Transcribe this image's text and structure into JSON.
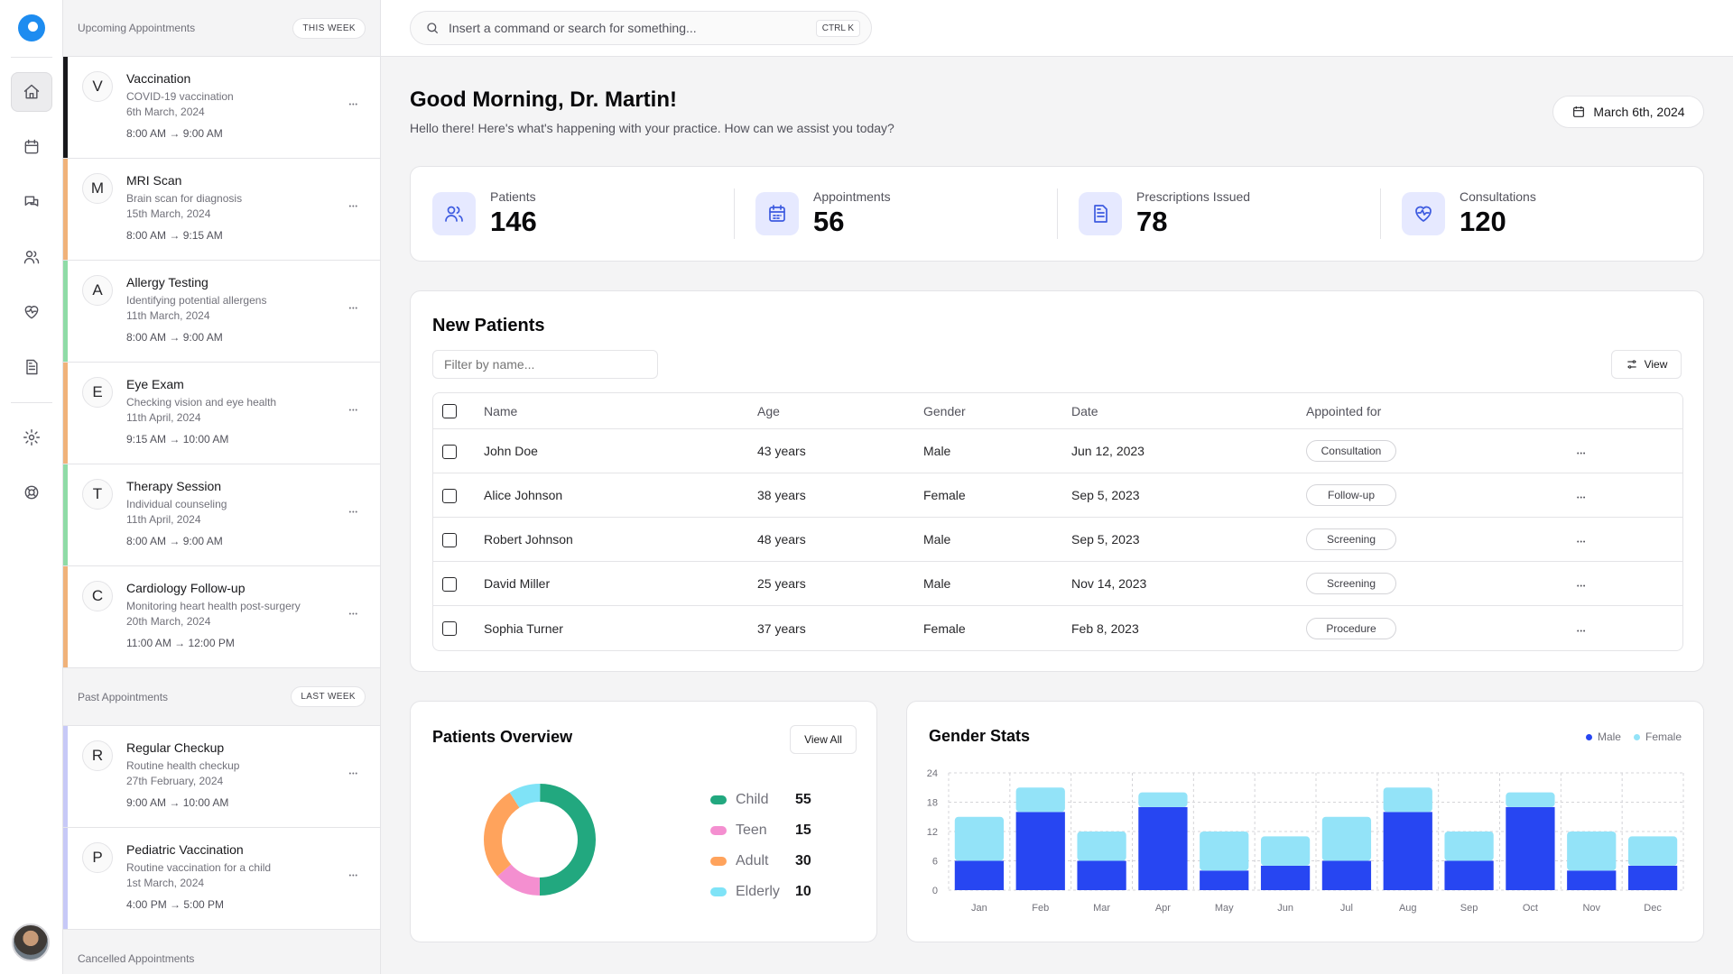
{
  "rail": {
    "items": [
      {
        "icon": "home-icon",
        "active": true
      },
      {
        "icon": "calendar-icon",
        "active": false
      },
      {
        "icon": "messages-icon",
        "active": false
      },
      {
        "icon": "users-icon",
        "active": false
      },
      {
        "icon": "heart-pulse-icon",
        "active": false
      },
      {
        "icon": "document-icon",
        "active": false
      },
      {
        "icon": "settings-icon",
        "active": false
      },
      {
        "icon": "help-icon",
        "active": false
      }
    ]
  },
  "upcoming": {
    "title": "Upcoming Appointments",
    "badge": "THIS WEEK",
    "items": [
      {
        "letter": "V",
        "title": "Vaccination",
        "desc": "COVID-19 vaccination",
        "date": "6th March, 2024",
        "time": "8:00 AM → 9:00 AM",
        "color": "#18181b"
      },
      {
        "letter": "M",
        "title": "MRI Scan",
        "desc": "Brain scan for diagnosis",
        "date": "15th March, 2024",
        "time": "8:00 AM → 9:15 AM",
        "color": "#f0b27a"
      },
      {
        "letter": "A",
        "title": "Allergy Testing",
        "desc": "Identifying potential allergens",
        "date": "11th March, 2024",
        "time": "8:00 AM → 9:00 AM",
        "color": "#8fdba6"
      },
      {
        "letter": "E",
        "title": "Eye Exam",
        "desc": "Checking vision and eye health",
        "date": "11th April, 2024",
        "time": "9:15 AM → 10:00 AM",
        "color": "#f0b27a"
      },
      {
        "letter": "T",
        "title": "Therapy Session",
        "desc": "Individual counseling",
        "date": "11th April, 2024",
        "time": "8:00 AM → 9:00 AM",
        "color": "#8fdba6"
      },
      {
        "letter": "C",
        "title": "Cardiology Follow-up",
        "desc": "Monitoring heart health post-surgery",
        "date": "20th March, 2024",
        "time": "11:00 AM → 12:00 PM",
        "color": "#f0b27a"
      }
    ]
  },
  "past": {
    "title": "Past Appointments",
    "badge": "LAST WEEK",
    "items": [
      {
        "letter": "R",
        "title": "Regular Checkup",
        "desc": "Routine health checkup",
        "date": "27th February, 2024",
        "time": "9:00 AM → 10:00 AM",
        "color": "#c7c9f7"
      },
      {
        "letter": "P",
        "title": "Pediatric Vaccination",
        "desc": "Routine vaccination for a child",
        "date": "1st March, 2024",
        "time": "4:00 PM → 5:00 PM",
        "color": "#c7c9f7"
      }
    ]
  },
  "cancelled": {
    "title": "Cancelled Appointments"
  },
  "search": {
    "placeholder": "Insert a command or search for something...",
    "shortcut": "CTRL K"
  },
  "greeting": {
    "title": "Good Morning, Dr. Martin!",
    "subtitle": "Hello there! Here's what's happening with your practice. How can we assist you today?",
    "date": "March 6th, 2024"
  },
  "stats": [
    {
      "label": "Patients",
      "value": "146",
      "icon": "users-icon"
    },
    {
      "label": "Appointments",
      "value": "56",
      "icon": "calendar-icon"
    },
    {
      "label": "Prescriptions Issued",
      "value": "78",
      "icon": "document-icon"
    },
    {
      "label": "Consultations",
      "value": "120",
      "icon": "heart-pulse-icon"
    }
  ],
  "new_patients": {
    "title": "New Patients",
    "filter_placeholder": "Filter by name...",
    "view_label": "View",
    "columns": [
      "Name",
      "Age",
      "Gender",
      "Date",
      "Appointed for"
    ],
    "rows": [
      {
        "name": "John Doe",
        "age": "43 years",
        "gender": "Male",
        "date": "Jun 12, 2023",
        "for": "Consultation"
      },
      {
        "name": "Alice Johnson",
        "age": "38 years",
        "gender": "Female",
        "date": "Sep 5, 2023",
        "for": "Follow-up"
      },
      {
        "name": "Robert Johnson",
        "age": "48 years",
        "gender": "Male",
        "date": "Sep 5, 2023",
        "for": "Screening"
      },
      {
        "name": "David Miller",
        "age": "25 years",
        "gender": "Male",
        "date": "Nov 14, 2023",
        "for": "Screening"
      },
      {
        "name": "Sophia Turner",
        "age": "37 years",
        "gender": "Female",
        "date": "Feb 8, 2023",
        "for": "Procedure"
      }
    ]
  },
  "overview": {
    "title": "Patients Overview",
    "view_all": "View All",
    "segments": [
      {
        "name": "Child",
        "value": 55,
        "color": "#22a87f"
      },
      {
        "name": "Teen",
        "value": 15,
        "color": "#f48fd0"
      },
      {
        "name": "Adult",
        "value": 30,
        "color": "#ffa35c"
      },
      {
        "name": "Elderly",
        "value": 10,
        "color": "#7fe3f7"
      }
    ]
  },
  "chart_data": {
    "type": "bar",
    "title": "Gender Stats",
    "stacked": true,
    "categories": [
      "Jan",
      "Feb",
      "Mar",
      "Apr",
      "May",
      "Jun",
      "Jul",
      "Aug",
      "Sep",
      "Oct",
      "Nov",
      "Dec"
    ],
    "series": [
      {
        "name": "Male",
        "color": "#2746f2",
        "values": [
          6,
          16,
          6,
          17,
          4,
          5,
          6,
          16,
          6,
          17,
          4,
          5
        ]
      },
      {
        "name": "Female",
        "color": "#93e3f8",
        "values": [
          9,
          5,
          6,
          3,
          8,
          6,
          9,
          5,
          6,
          3,
          8,
          6
        ]
      }
    ],
    "yticks": [
      0,
      6,
      12,
      18,
      24
    ],
    "ylim": [
      0,
      24
    ],
    "grid": true,
    "legend": "top-right"
  }
}
